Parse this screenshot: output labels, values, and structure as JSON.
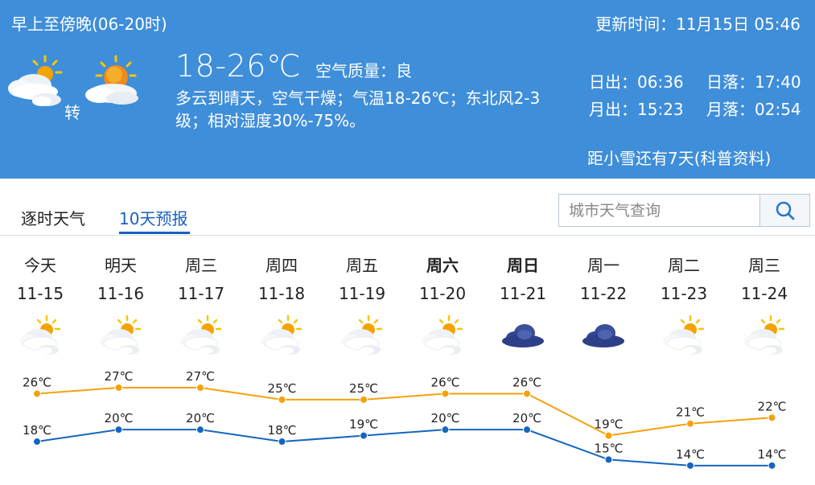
{
  "header": {
    "period": "早上至傍晚(06-20时)",
    "updated_label": "更新时间：",
    "updated_value": "11月15日 05:46",
    "weather_icons": [
      "partly-cloudy-icon",
      "sunny-cloudy-icon"
    ],
    "transition": "转",
    "temp_range": "18-26℃",
    "air_quality_label": "空气质量：",
    "air_quality_value": "良",
    "description": "多云到晴天，空气干燥；气温18-26℃；东北风2-3级；相对湿度30%-75%。",
    "sunrise_label": "日出：",
    "sunrise_value": "06:36",
    "sunset_label": "日落：",
    "sunset_value": "17:40",
    "moonrise_label": "月出：",
    "moonrise_value": "15:23",
    "moonset_label": "月落：",
    "moonset_value": "02:54",
    "solar_term_note": "距小雪还有7天(科普资料)"
  },
  "tabs": [
    {
      "label": "逐时天气",
      "active": false
    },
    {
      "label": "10天预报",
      "active": true
    }
  ],
  "search": {
    "placeholder": "城市天气查询",
    "button_icon": "search-icon"
  },
  "colors": {
    "header_bg": "#3f8ed9",
    "tab_active": "#1a62c2",
    "high_line": "#f5a20a",
    "low_line": "#1565c0"
  },
  "forecast": {
    "days": [
      {
        "weekday": "今天",
        "date": "11-15",
        "icon": "partly-cloudy-icon",
        "bold": false
      },
      {
        "weekday": "明天",
        "date": "11-16",
        "icon": "partly-cloudy-icon",
        "bold": false
      },
      {
        "weekday": "周三",
        "date": "11-17",
        "icon": "partly-cloudy-icon",
        "bold": false
      },
      {
        "weekday": "周四",
        "date": "11-18",
        "icon": "partly-cloudy-icon",
        "bold": false
      },
      {
        "weekday": "周五",
        "date": "11-19",
        "icon": "partly-cloudy-icon",
        "bold": false
      },
      {
        "weekday": "周六",
        "date": "11-20",
        "icon": "partly-cloudy-icon",
        "bold": true
      },
      {
        "weekday": "周日",
        "date": "11-21",
        "icon": "cloudy-icon",
        "bold": true
      },
      {
        "weekday": "周一",
        "date": "11-22",
        "icon": "cloudy-icon",
        "bold": false
      },
      {
        "weekday": "周二",
        "date": "11-23",
        "icon": "partly-cloudy-icon",
        "bold": false
      },
      {
        "weekday": "周三",
        "date": "11-24",
        "icon": "partly-cloudy-icon",
        "bold": false
      }
    ]
  },
  "chart_data": {
    "type": "line",
    "x": [
      "11-15",
      "11-16",
      "11-17",
      "11-18",
      "11-19",
      "11-20",
      "11-21",
      "11-22",
      "11-23",
      "11-24"
    ],
    "series": [
      {
        "values": [
          26,
          27,
          27,
          25,
          25,
          26,
          26,
          19,
          21,
          22
        ],
        "labels": [
          "26℃",
          "27℃",
          "27℃",
          "25℃",
          "25℃",
          "26℃",
          "26℃",
          "19℃",
          "21℃",
          "22℃"
        ]
      },
      {
        "values": [
          18,
          20,
          20,
          18,
          19,
          20,
          20,
          15,
          14,
          14
        ],
        "labels": [
          "18℃",
          "20℃",
          "20℃",
          "18℃",
          "19℃",
          "20℃",
          "20℃",
          "15℃",
          "14℃",
          "14℃"
        ]
      }
    ],
    "grid": false,
    "legend": "none"
  }
}
